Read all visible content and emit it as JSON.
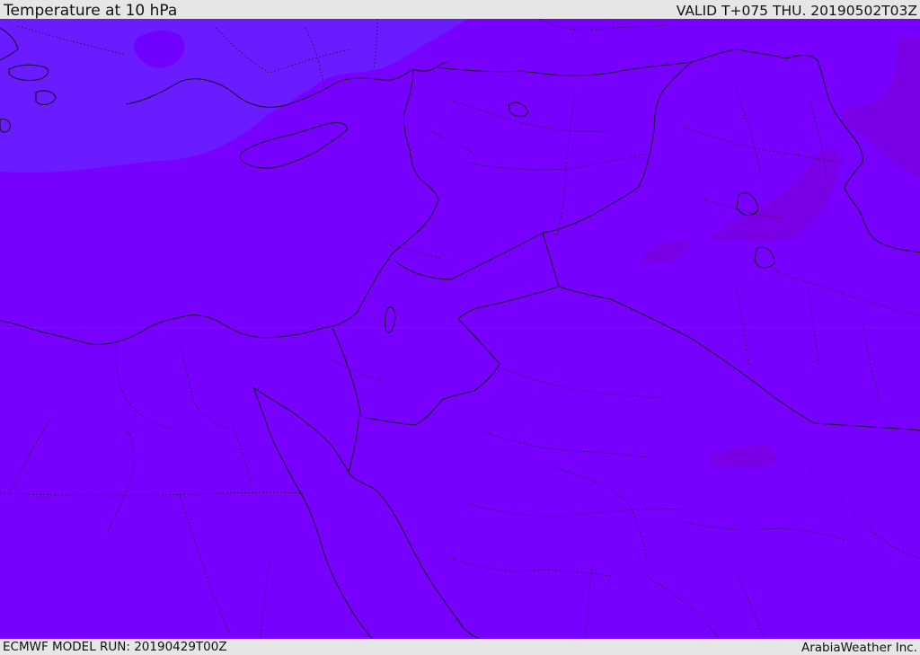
{
  "header": {
    "title": "Temperature at 10 hPa",
    "valid_time": "VALID T+075 THU. 20190502T03Z"
  },
  "footer": {
    "model_run": "ECMWF MODEL RUN: 20190429T00Z",
    "credit": "ArabiaWeather Inc."
  },
  "map": {
    "base_fill_color": "#7800ff",
    "cooler_region_color": "#6a1bff",
    "warmer_patch_color": "#7a00e6",
    "coastline_color": "#111111",
    "border_color": "#111111"
  }
}
